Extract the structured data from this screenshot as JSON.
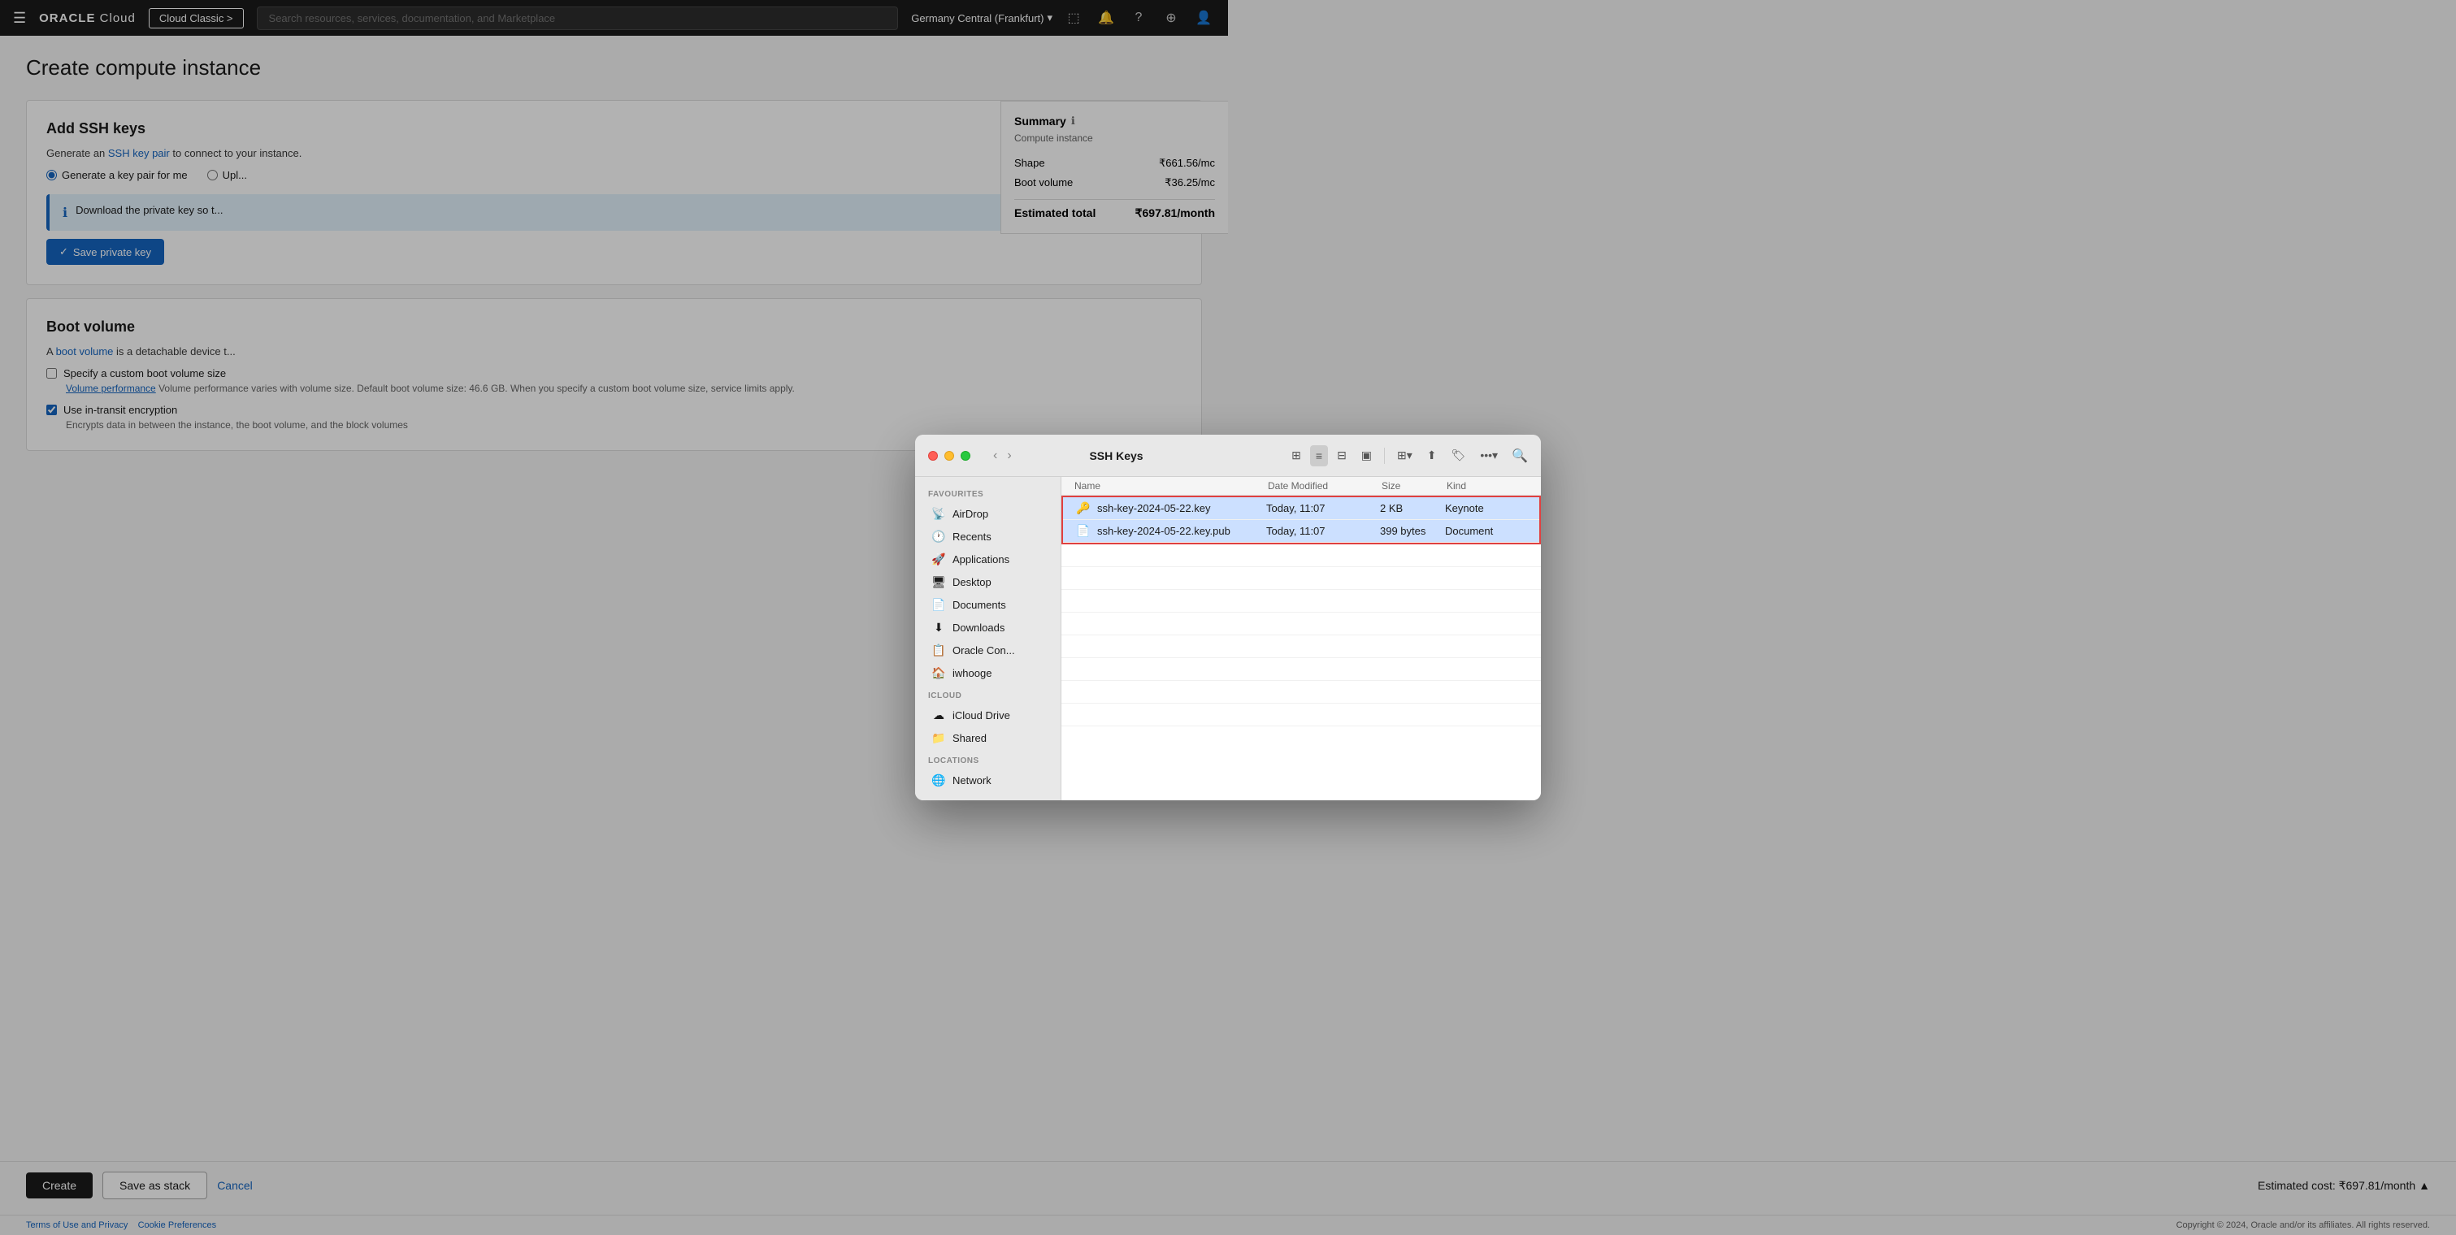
{
  "nav": {
    "hamburger": "☰",
    "oracle_logo": "ORACLE Cloud",
    "cloud_classic": "Cloud Classic >",
    "search_placeholder": "Search resources, services, documentation, and Marketplace",
    "region": "Germany Central (Frankfurt)",
    "icons": [
      "⬚",
      "🔔",
      "?",
      "⊕",
      "👤"
    ]
  },
  "page": {
    "title": "Create compute instance"
  },
  "ssh_section": {
    "title": "Add SSH keys",
    "info_text_prefix": "Generate an ",
    "ssh_link": "SSH key pair",
    "info_text_suffix": " to connect to your instance.",
    "radio_options": [
      {
        "id": "gen-key",
        "label": "Generate a key pair for me",
        "checked": true
      },
      {
        "id": "upload",
        "label": "Upl...",
        "checked": false
      }
    ],
    "info_box_text": "Download the private key so t...",
    "save_btn": "Save private key"
  },
  "boot_section": {
    "title": "Boot volume",
    "text_prefix": "A ",
    "boot_link": "boot volume",
    "text_suffix": " is a detachable device t...",
    "checkbox1": "Specify a custom boot volume size",
    "checkbox1_hint": "Volume performance varies with volume size. Default boot volume size: 46.6 GB. When you specify a custom boot volume size, service limits apply.",
    "volume_link": "Volume performance",
    "checkbox2": "Use in-transit encryption",
    "checkbox2_hint": "Encrypts data in between the instance, the boot volume, and the block volumes"
  },
  "summary": {
    "title": "Summary",
    "subtitle": "Compute instance",
    "shape_label": "Shape",
    "shape_value": "₹661.56/mc",
    "boot_label": "Boot volume",
    "boot_value": "₹36.25/mc",
    "total_label": "Estimated total",
    "total_value": "₹697.81/month"
  },
  "bottom_bar": {
    "create": "Create",
    "save_as_stack": "Save as stack",
    "cancel": "Cancel",
    "cost": "Estimated cost: ₹697.81/month",
    "chevron": "▲"
  },
  "footer": {
    "terms": "Terms of Use and Privacy",
    "cookies": "Cookie Preferences",
    "copyright": "Copyright © 2024, Oracle and/or its affiliates. All rights reserved."
  },
  "finder": {
    "title": "SSH Keys",
    "back_arrow": "‹",
    "forward_arrow": "›",
    "sidebar": {
      "favourites_label": "Favourites",
      "items": [
        {
          "icon": "📡",
          "label": "AirDrop"
        },
        {
          "icon": "🕐",
          "label": "Recents"
        },
        {
          "icon": "🚀",
          "label": "Applications"
        },
        {
          "icon": "🖥",
          "label": "Desktop"
        },
        {
          "icon": "📄",
          "label": "Documents"
        },
        {
          "icon": "⬇",
          "label": "Downloads"
        },
        {
          "icon": "📋",
          "label": "Oracle Con..."
        },
        {
          "icon": "🏠",
          "label": "iwhooge"
        }
      ],
      "icloud_label": "iCloud",
      "icloud_items": [
        {
          "icon": "☁",
          "label": "iCloud Drive"
        },
        {
          "icon": "📁",
          "label": "Shared"
        }
      ],
      "locations_label": "Locations",
      "location_items": [
        {
          "icon": "🌐",
          "label": "Network"
        }
      ]
    },
    "columns": {
      "name": "Name",
      "modified": "Date Modified",
      "size": "Size",
      "kind": "Kind"
    },
    "files": [
      {
        "icon": "🔑",
        "name": "ssh-key-2024-05-22.key",
        "modified": "Today, 11:07",
        "size": "2 KB",
        "kind": "Keynote",
        "selected": true,
        "highlighted": true
      },
      {
        "icon": "📄",
        "name": "ssh-key-2024-05-22.key.pub",
        "modified": "Today, 11:07",
        "size": "399 bytes",
        "kind": "Document",
        "selected": false,
        "highlighted": true
      }
    ],
    "empty_rows": 8
  }
}
